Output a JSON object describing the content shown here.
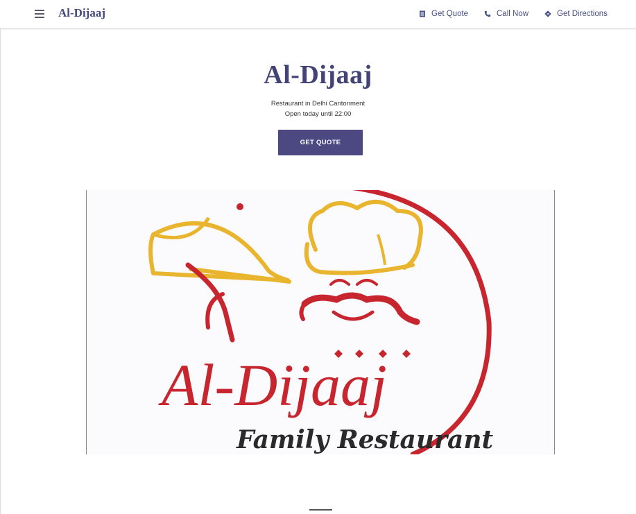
{
  "header": {
    "brand": "Al-Dijaaj",
    "nav": {
      "get_quote": "Get Quote",
      "call_now": "Call Now",
      "get_directions": "Get Directions"
    }
  },
  "hero": {
    "title": "Al-Dijaaj",
    "category": "Restaurant in Delhi Cantonment",
    "hours": "Open today until 22:00",
    "cta_label": "GET QUOTE"
  },
  "logo": {
    "name": "Al-Dijaaj",
    "tagline": "Family Restaurant"
  },
  "colors": {
    "accent": "#4b4882",
    "brand_text": "#444a80",
    "logo_red": "#c8262e",
    "logo_gold": "#eab52e"
  }
}
